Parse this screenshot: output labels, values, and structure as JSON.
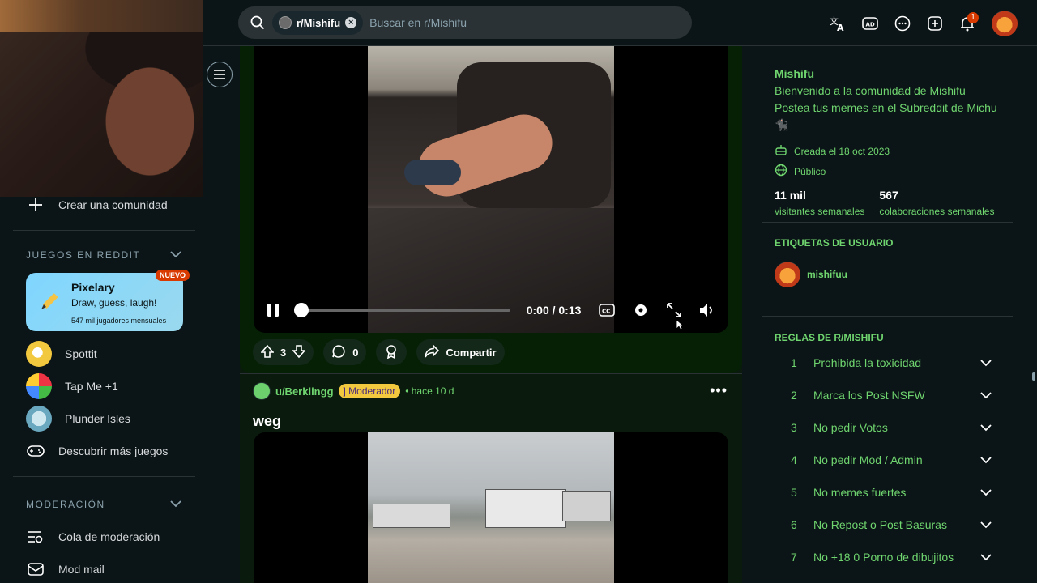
{
  "search": {
    "chip": "r/Mishifu",
    "placeholder": "Buscar en r/Mishifu"
  },
  "topbar": {
    "notif_count": "1"
  },
  "left": {
    "create": "Crear una comunidad",
    "games_header": "JUEGOS EN REDDIT",
    "featured": {
      "title": "Pixelary",
      "sub": "Draw, guess, laugh!",
      "meta": "547 mil jugadores mensuales",
      "badge": "NUEVO"
    },
    "games": [
      "Spottit",
      "Tap Me +1",
      "Plunder Isles"
    ],
    "discover": "Descubrir más juegos",
    "mod_header": "MODERACIÓN",
    "mod_items": [
      "Cola de moderación",
      "Mod mail"
    ]
  },
  "post1": {
    "time": "0:00 / 0:13",
    "score": "3",
    "comments": "0",
    "share": "Compartir",
    "progress": 0
  },
  "post2": {
    "user": "u/Berklingg",
    "badge": "] Moderador",
    "time": "• hace 10 d",
    "title": "weg"
  },
  "about": {
    "name": "Mishifu",
    "desc": "Bienvenido a la comunidad de Mishifu Postea tus memes en el Subreddit de Michu 🐈‍⬛",
    "created": "Creada el 18 oct 2023",
    "visibility": "Público",
    "stat1_v": "11 mil",
    "stat1_l": "visitantes semanales",
    "stat2_v": "567",
    "stat2_l": "colaboraciones semanales"
  },
  "flair": {
    "header": "ETIQUETAS DE USUARIO",
    "user": "mishifuu"
  },
  "rules": {
    "header": "REGLAS DE R/MISHIFU",
    "items": [
      {
        "n": "1",
        "t": "Prohibida la toxicidad"
      },
      {
        "n": "2",
        "t": "Marca los Post NSFW"
      },
      {
        "n": "3",
        "t": "No pedir Votos"
      },
      {
        "n": "4",
        "t": "No pedir Mod / Admin"
      },
      {
        "n": "5",
        "t": "No memes fuertes"
      },
      {
        "n": "6",
        "t": "No Repost o Post Basuras"
      },
      {
        "n": "7",
        "t": "No +18 0 Porno de dibujitos"
      }
    ]
  },
  "colors": {
    "accent": "#6fd56f",
    "bg": "#0b1416",
    "notif": "#d93a00"
  }
}
